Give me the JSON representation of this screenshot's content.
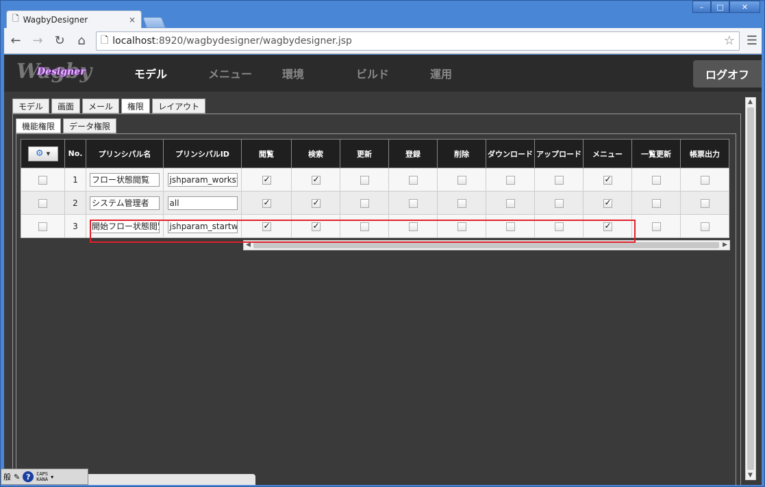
{
  "browser": {
    "tab_title": "WagbyDesigner",
    "url_host": "localhost",
    "url_rest": ":8920/wagbydesigner/wagbydesigner.jsp",
    "win_minimize": "–",
    "win_maximize": "□",
    "win_close": "✕"
  },
  "app": {
    "logo_main": "Wagby",
    "logo_sub": "Designer",
    "nav": [
      "モデル",
      "メニュー",
      "環境",
      "ビルド",
      "運用"
    ],
    "logoff": "ログオフ"
  },
  "subtabs": [
    "モデル",
    "画面",
    "メール",
    "権限",
    "レイアウト"
  ],
  "subsubtabs": [
    "機能権限",
    "データ権限"
  ],
  "grid": {
    "headers": [
      "No.",
      "プリンシパル名",
      "プリンシパルID",
      "閲覧",
      "検索",
      "更新",
      "登録",
      "削除",
      "ダウンロード",
      "アップロード",
      "メニュー",
      "一覧更新",
      "帳票出力"
    ],
    "rows": [
      {
        "no": "1",
        "name": "フロー状態閲覧",
        "id": "jshparam_workst",
        "checks": [
          true,
          true,
          false,
          false,
          false,
          false,
          false,
          true,
          false,
          false
        ]
      },
      {
        "no": "2",
        "name": "システム管理者",
        "id": "all",
        "checks": [
          true,
          true,
          false,
          false,
          false,
          false,
          false,
          true,
          false,
          false
        ]
      },
      {
        "no": "3",
        "name": "開始フロー状態閲覧",
        "id": "jshparam_startw",
        "checks": [
          true,
          true,
          false,
          false,
          false,
          false,
          false,
          true,
          false,
          false
        ]
      }
    ]
  },
  "ime": {
    "caps": "CAPS",
    "kana": "KANA",
    "help": "?"
  },
  "colors": {
    "highlight": "#e0202a",
    "header_bg": "#1f1f1f",
    "content_bg": "#3a3a3a"
  }
}
